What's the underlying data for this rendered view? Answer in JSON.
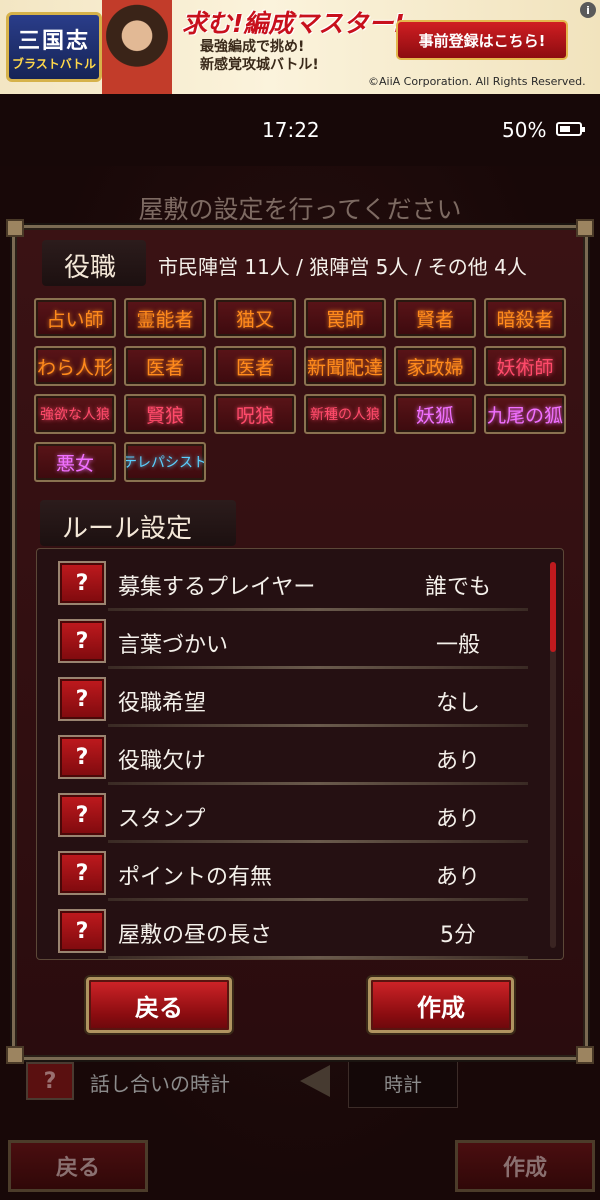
{
  "ad": {
    "logo_line1": "三国志",
    "logo_line2": "ブラストバトル",
    "headline": "求む!編成マスター!",
    "sub_line1": "最強編成で挑め!",
    "sub_line2": "新感覚攻城バトル!",
    "cta": "事前登録はこちら!",
    "copyright": "©AiiA Corporation. All Rights Reserved.",
    "info": "i"
  },
  "status_bar": {
    "time": "17:22",
    "battery": "50%"
  },
  "background": {
    "title": "屋敷の設定を行ってください",
    "row_label": "話し合いの時計",
    "row_value": "時計",
    "back": "戻る",
    "create": "作成",
    "q": "?"
  },
  "roles": {
    "title": "役職",
    "summary": "市民陣営 11人 / 狼陣営 5人 / その他 4人",
    "items": [
      {
        "label": "占い師",
        "color": "#ff8a1c"
      },
      {
        "label": "霊能者",
        "color": "#ff8a1c"
      },
      {
        "label": "猫又",
        "color": "#ff8a1c"
      },
      {
        "label": "罠師",
        "color": "#ff8a1c"
      },
      {
        "label": "賢者",
        "color": "#ff8a1c"
      },
      {
        "label": "暗殺者",
        "color": "#ff8a1c"
      },
      {
        "label": "わら人形",
        "color": "#ff8a1c"
      },
      {
        "label": "医者",
        "color": "#ff8a1c"
      },
      {
        "label": "医者",
        "color": "#ff8a1c"
      },
      {
        "label": "新聞配達",
        "color": "#ff8a1c"
      },
      {
        "label": "家政婦",
        "color": "#ff8a1c"
      },
      {
        "label": "妖術師",
        "color": "#ff4a6a"
      },
      {
        "label": "強欲な人狼",
        "color": "#ff4a6a"
      },
      {
        "label": "賢狼",
        "color": "#ff4a6a"
      },
      {
        "label": "呪狼",
        "color": "#ff4a6a"
      },
      {
        "label": "新種の人狼",
        "color": "#ff4a6a"
      },
      {
        "label": "妖狐",
        "color": "#f070ff"
      },
      {
        "label": "九尾の狐",
        "color": "#f070ff"
      },
      {
        "label": "悪女",
        "color": "#f070ff"
      },
      {
        "label": "テレパシスト",
        "color": "#5ad0ff"
      }
    ]
  },
  "rules": {
    "title": "ルール設定",
    "items": [
      {
        "q": "?",
        "label": "募集するプレイヤー",
        "value": "誰でも"
      },
      {
        "q": "?",
        "label": "言葉づかい",
        "value": "一般"
      },
      {
        "q": "?",
        "label": "役職希望",
        "value": "なし"
      },
      {
        "q": "?",
        "label": "役職欠け",
        "value": "あり"
      },
      {
        "q": "?",
        "label": "スタンプ",
        "value": "あり"
      },
      {
        "q": "?",
        "label": "ポイントの有無",
        "value": "あり"
      },
      {
        "q": "?",
        "label": "屋敷の昼の長さ",
        "value": "5分"
      }
    ]
  },
  "actions": {
    "back": "戻る",
    "create": "作成"
  }
}
